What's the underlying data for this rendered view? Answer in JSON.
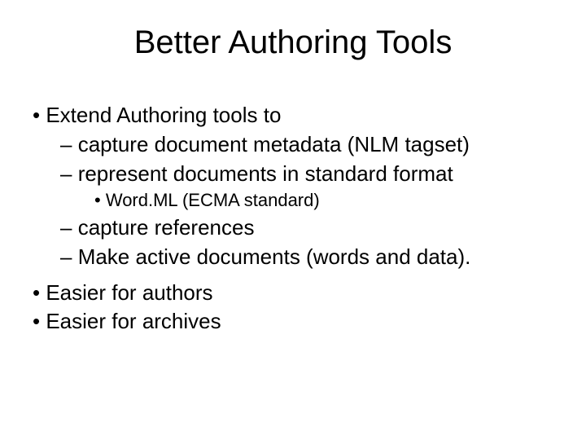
{
  "title": "Better Authoring Tools",
  "items": {
    "b1": "Extend Authoring tools to",
    "b1_1": "capture document metadata  (NLM tagset)",
    "b1_2": "represent documents in standard format",
    "b1_2_1": "Word.ML (ECMA standard)",
    "b1_3": "capture references",
    "b1_4": "Make active documents (words and data).",
    "b2": "Easier for authors",
    "b3": "Easier for archives"
  }
}
